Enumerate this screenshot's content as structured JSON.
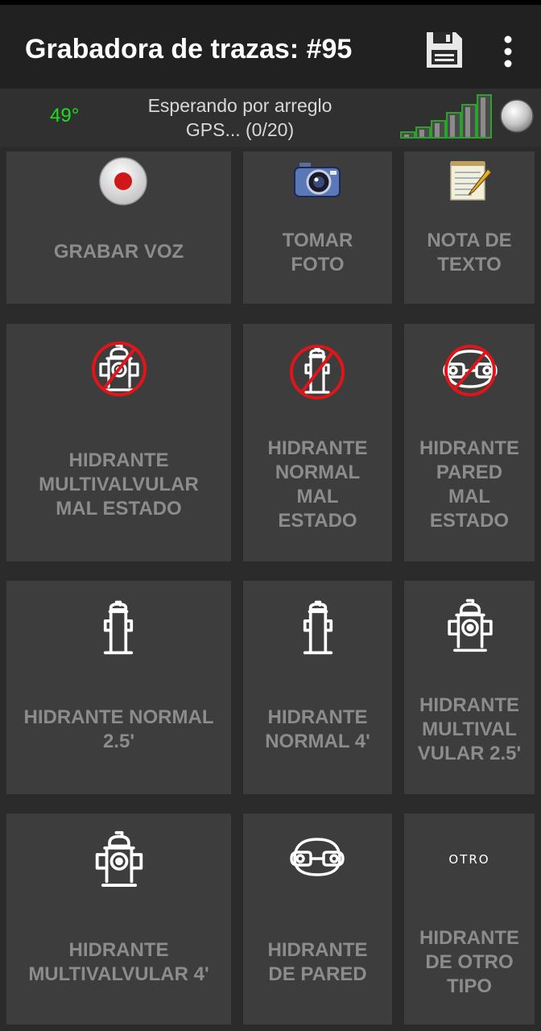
{
  "app": {
    "title": "Grabadora de trazas: #95"
  },
  "gps": {
    "heading": "49°",
    "status": "Esperando por arreglo GPS... (0/20)"
  },
  "icons": {
    "save": "floppy-disk-icon",
    "menu": "more-vert-icon",
    "signal": "signal-strength-icon",
    "gps_led": "gps-status-led-icon"
  },
  "colors": {
    "heading_text": "#1ede1e",
    "record_red": "#d01818",
    "strike_red": "#e0151a",
    "label_gray": "#8c8c8c",
    "tile_bg": "#3d3d3d",
    "signal_green": "#29a329"
  },
  "buttons": {
    "voice": {
      "label": "GRABAR VOZ",
      "icon": "record-icon"
    },
    "photo": {
      "label": "TOMAR\nFOTO",
      "icon": "camera-icon"
    },
    "note": {
      "label": "NOTA DE\nTEXTO",
      "icon": "notepad-icon"
    },
    "multi_bad": {
      "label": "HIDRANTE\nMULTIVALVULAR\nMAL ESTADO",
      "icon": "multivalve-hydrant-crossed-icon"
    },
    "normal_bad": {
      "label": "HIDRANTE\nNORMAL\nMAL\nESTADO",
      "icon": "normal-hydrant-crossed-icon"
    },
    "wall_bad": {
      "label": "HIDRANTE\nPARED\nMAL\nESTADO",
      "icon": "wall-hydrant-crossed-icon"
    },
    "normal_25": {
      "label": "HIDRANTE NORMAL\n2.5'",
      "icon": "normal-hydrant-icon"
    },
    "normal_4": {
      "label": "HIDRANTE\nNORMAL 4'",
      "icon": "normal-hydrant-icon"
    },
    "multi_25": {
      "label": "HIDRANTE\nMULTIVAL\nVULAR 2.5'",
      "icon": "multivalve-hydrant-icon"
    },
    "multi_4": {
      "label": "HIDRANTE\nMULTIVALVULAR 4'",
      "icon": "multivalve-hydrant-icon"
    },
    "wall": {
      "label": "HIDRANTE\nDE PARED",
      "icon": "wall-hydrant-icon"
    },
    "other": {
      "label": "HIDRANTE\nDE OTRO\nTIPO",
      "icon": "otro-icon",
      "icon_text": "OTRO"
    }
  }
}
